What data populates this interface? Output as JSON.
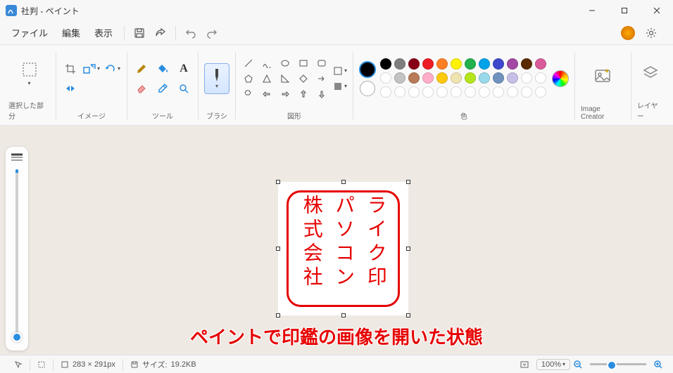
{
  "window": {
    "title": "社判 - ペイント"
  },
  "menu": {
    "file": "ファイル",
    "edit": "編集",
    "view": "表示"
  },
  "ribbon": {
    "groups": {
      "selection": "選択した部分",
      "image": "イメージ",
      "tools": "ツール",
      "brushes": "ブラシ",
      "shapes": "図形",
      "colors": "色",
      "image_creator": "Image Creator",
      "layers": "レイヤー"
    }
  },
  "colors": {
    "current_primary": "#000000",
    "current_secondary": "#ffffff",
    "palette_row1": [
      "#000000",
      "#7f7f7f",
      "#880015",
      "#ed1c24",
      "#ff7f27",
      "#fff200",
      "#22b14c",
      "#00a2e8",
      "#3f48cc",
      "#a349a4",
      "#5a2a00",
      "#d95b9a"
    ],
    "palette_row2": [
      "#ffffff",
      "#c3c3c3",
      "#b97a57",
      "#ffaec9",
      "#ffc90e",
      "#efe4b0",
      "#b5e61d",
      "#99d9ea",
      "#7092be",
      "#c8bfe7",
      "#ffffff",
      "#ffffff"
    ],
    "palette_row3": [
      "#ffffff",
      "#ffffff",
      "#ffffff",
      "#ffffff",
      "#ffffff",
      "#ffffff",
      "#ffffff",
      "#ffffff",
      "#ffffff",
      "#ffffff",
      "#ffffff",
      "#ffffff"
    ]
  },
  "canvas": {
    "stamp_col1": "株式会社",
    "stamp_col2": "パソコン",
    "stamp_col3": "ライク印"
  },
  "annotation": "ペイントで印鑑の画像を開いた状態",
  "status": {
    "dimensions": "283 × 291px",
    "size_label": "サイズ:",
    "size_value": "19.2KB",
    "zoom": "100%"
  }
}
